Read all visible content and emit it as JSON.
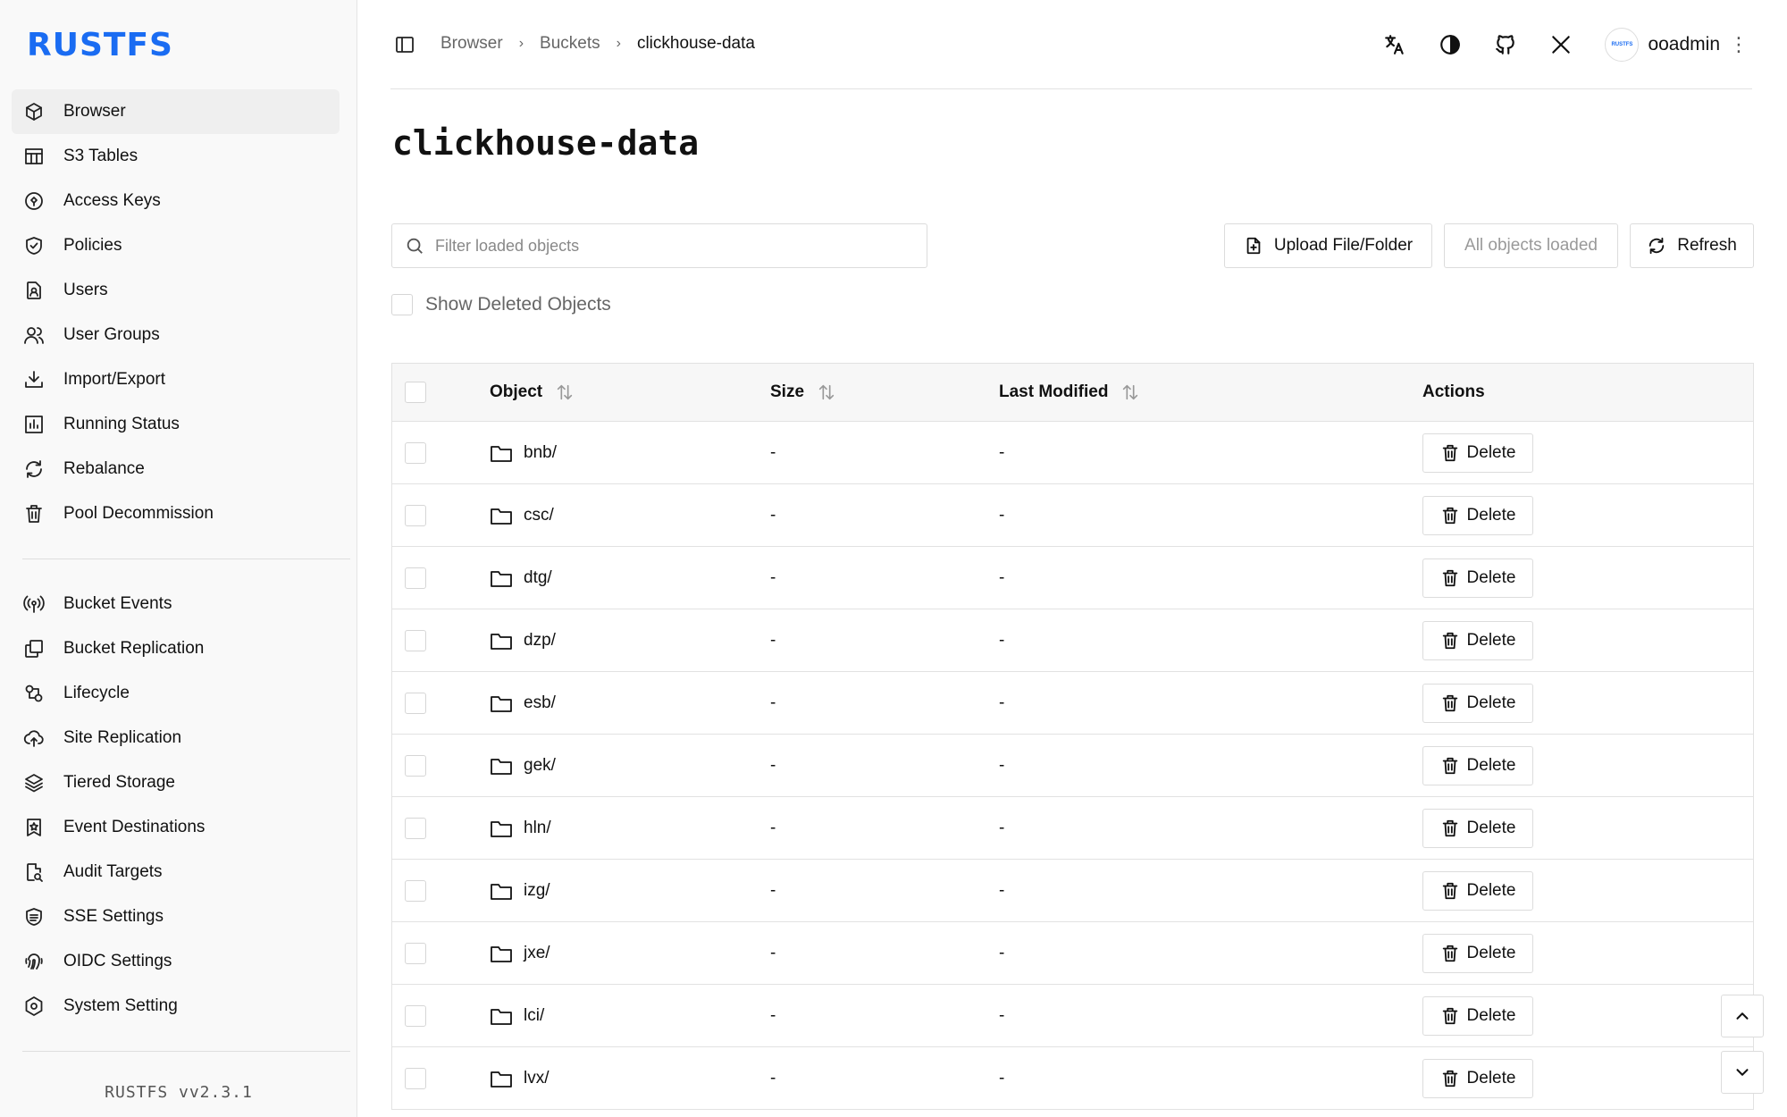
{
  "app": {
    "logo": "RUSTFS",
    "version": "RUSTFS vv2.3.1"
  },
  "sidebar": {
    "primary": [
      {
        "label": "Browser",
        "icon": "cube-icon",
        "active": true
      },
      {
        "label": "S3 Tables",
        "icon": "table-icon"
      },
      {
        "label": "Access Keys",
        "icon": "key-circle-icon"
      },
      {
        "label": "Policies",
        "icon": "shield-check-icon"
      },
      {
        "label": "Users",
        "icon": "user-badge-icon"
      },
      {
        "label": "User Groups",
        "icon": "users-icon"
      },
      {
        "label": "Import/Export",
        "icon": "download-tray-icon"
      },
      {
        "label": "Running Status",
        "icon": "bar-chart-icon"
      },
      {
        "label": "Rebalance",
        "icon": "refresh-icon"
      },
      {
        "label": "Pool Decommission",
        "icon": "trash-icon"
      }
    ],
    "secondary": [
      {
        "label": "Bucket Events",
        "icon": "broadcast-icon"
      },
      {
        "label": "Bucket Replication",
        "icon": "copy-icon"
      },
      {
        "label": "Lifecycle",
        "icon": "lifecycle-icon"
      },
      {
        "label": "Site Replication",
        "icon": "cloud-upload-icon"
      },
      {
        "label": "Tiered Storage",
        "icon": "layers-icon"
      },
      {
        "label": "Event Destinations",
        "icon": "star-bookmark-icon"
      },
      {
        "label": "Audit Targets",
        "icon": "file-search-icon"
      },
      {
        "label": "SSE Settings",
        "icon": "encryption-icon"
      },
      {
        "label": "OIDC Settings",
        "icon": "fingerprint-icon"
      },
      {
        "label": "System Setting",
        "icon": "hex-gear-icon"
      }
    ]
  },
  "header": {
    "breadcrumb": [
      "Browser",
      "Buckets",
      "clickhouse-data"
    ],
    "icons": [
      "translate-icon",
      "theme-icon",
      "github-icon",
      "x-icon"
    ],
    "avatar_text": "RUSTFS",
    "user": "ooadmin"
  },
  "main": {
    "title": "clickhouse-data",
    "filter_placeholder": "Filter loaded objects",
    "upload_label": "Upload File/Folder",
    "loaded_label": "All objects loaded",
    "refresh_label": "Refresh",
    "show_deleted_label": "Show Deleted Objects"
  },
  "table": {
    "headers": {
      "object": "Object",
      "size": "Size",
      "modified": "Last Modified",
      "actions": "Actions"
    },
    "delete_label": "Delete",
    "rows": [
      {
        "name": "bnb/",
        "size": "-",
        "modified": "-"
      },
      {
        "name": "csc/",
        "size": "-",
        "modified": "-"
      },
      {
        "name": "dtg/",
        "size": "-",
        "modified": "-"
      },
      {
        "name": "dzp/",
        "size": "-",
        "modified": "-"
      },
      {
        "name": "esb/",
        "size": "-",
        "modified": "-"
      },
      {
        "name": "gek/",
        "size": "-",
        "modified": "-"
      },
      {
        "name": "hln/",
        "size": "-",
        "modified": "-"
      },
      {
        "name": "izg/",
        "size": "-",
        "modified": "-"
      },
      {
        "name": "jxe/",
        "size": "-",
        "modified": "-"
      },
      {
        "name": "lci/",
        "size": "-",
        "modified": "-"
      },
      {
        "name": "lvx/",
        "size": "-",
        "modified": "-"
      }
    ]
  },
  "colors": {
    "brand": "#1a6cf2"
  }
}
